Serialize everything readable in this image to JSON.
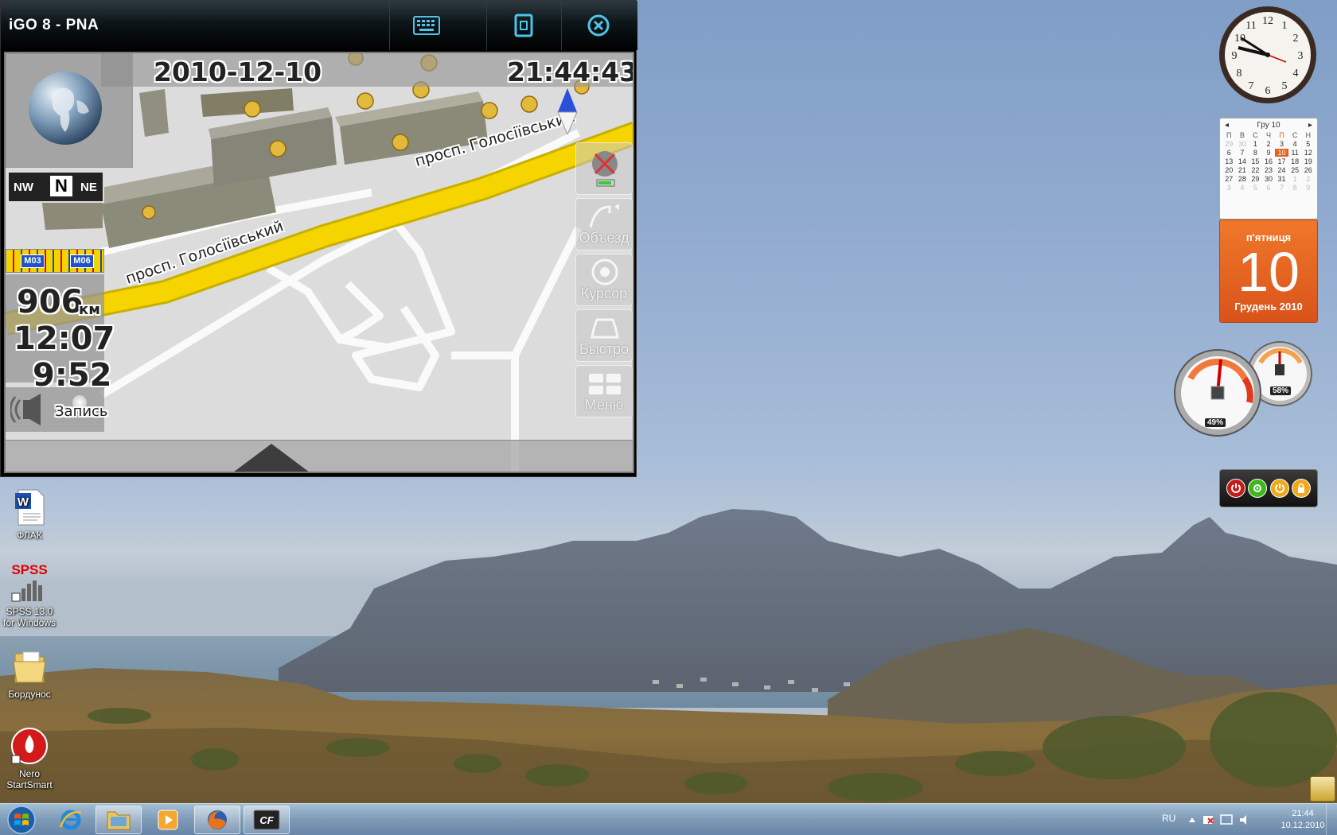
{
  "window": {
    "title": "iGO 8 - PNA",
    "buttons": [
      "keyboard-icon",
      "window-icon",
      "close-icon"
    ]
  },
  "map": {
    "date": "2010-12-10",
    "time": "21:44:43",
    "street_upper": "просп. Голосіївський",
    "street_lower": "просп. Голосіївський",
    "compass": {
      "left": "NW",
      "center": "N",
      "right": "NE"
    },
    "road_signs": [
      "M03",
      "M06"
    ],
    "distance": "906",
    "distance_unit": "км",
    "eta": "12:07",
    "remaining": "9:52",
    "record_label": "Запись",
    "side_buttons": [
      {
        "label": "",
        "icon": "no-gps-icon"
      },
      {
        "label": "Объезд",
        "icon": "detour-icon"
      },
      {
        "label": "Курсор",
        "icon": "cursor-icon"
      },
      {
        "label": "Быстро",
        "icon": "car-icon"
      },
      {
        "label": "Меню",
        "icon": "menu-grid-icon"
      }
    ]
  },
  "desktop_icons": [
    {
      "label": "ФЛАК",
      "icon": "word-document-icon"
    },
    {
      "label": "SPSS 13.0 for Windows",
      "icon": "spss-icon",
      "badge": "SPSS"
    },
    {
      "label": "Бордунос",
      "icon": "folder-icon"
    },
    {
      "label": "Nero StartSmart",
      "icon": "nero-icon"
    }
  ],
  "calendar": {
    "month_header": "Гру 10",
    "weekdays": [
      "П",
      "В",
      "С",
      "Ч",
      "П",
      "С",
      "Н"
    ],
    "weeks": [
      [
        "29",
        "30",
        "1",
        "2",
        "3",
        "4",
        "5"
      ],
      [
        "6",
        "7",
        "8",
        "9",
        "10",
        "11",
        "12"
      ],
      [
        "13",
        "14",
        "15",
        "16",
        "17",
        "18",
        "19"
      ],
      [
        "20",
        "21",
        "22",
        "23",
        "24",
        "25",
        "26"
      ],
      [
        "27",
        "28",
        "29",
        "30",
        "31",
        "1",
        "2"
      ],
      [
        "3",
        "4",
        "5",
        "6",
        "7",
        "8",
        "9"
      ]
    ],
    "day_of_week": "п'ятниця",
    "day": "10",
    "month_year": "Грудень 2010"
  },
  "meters": {
    "cpu": "49%",
    "memory": "58%"
  },
  "taskbar": {
    "apps": [
      "internet-explorer-icon",
      "explorer-icon",
      "media-player-icon",
      "firefox-icon",
      "cf-icon"
    ],
    "language": "RU",
    "time": "21:44",
    "date": "10.12.2010"
  }
}
